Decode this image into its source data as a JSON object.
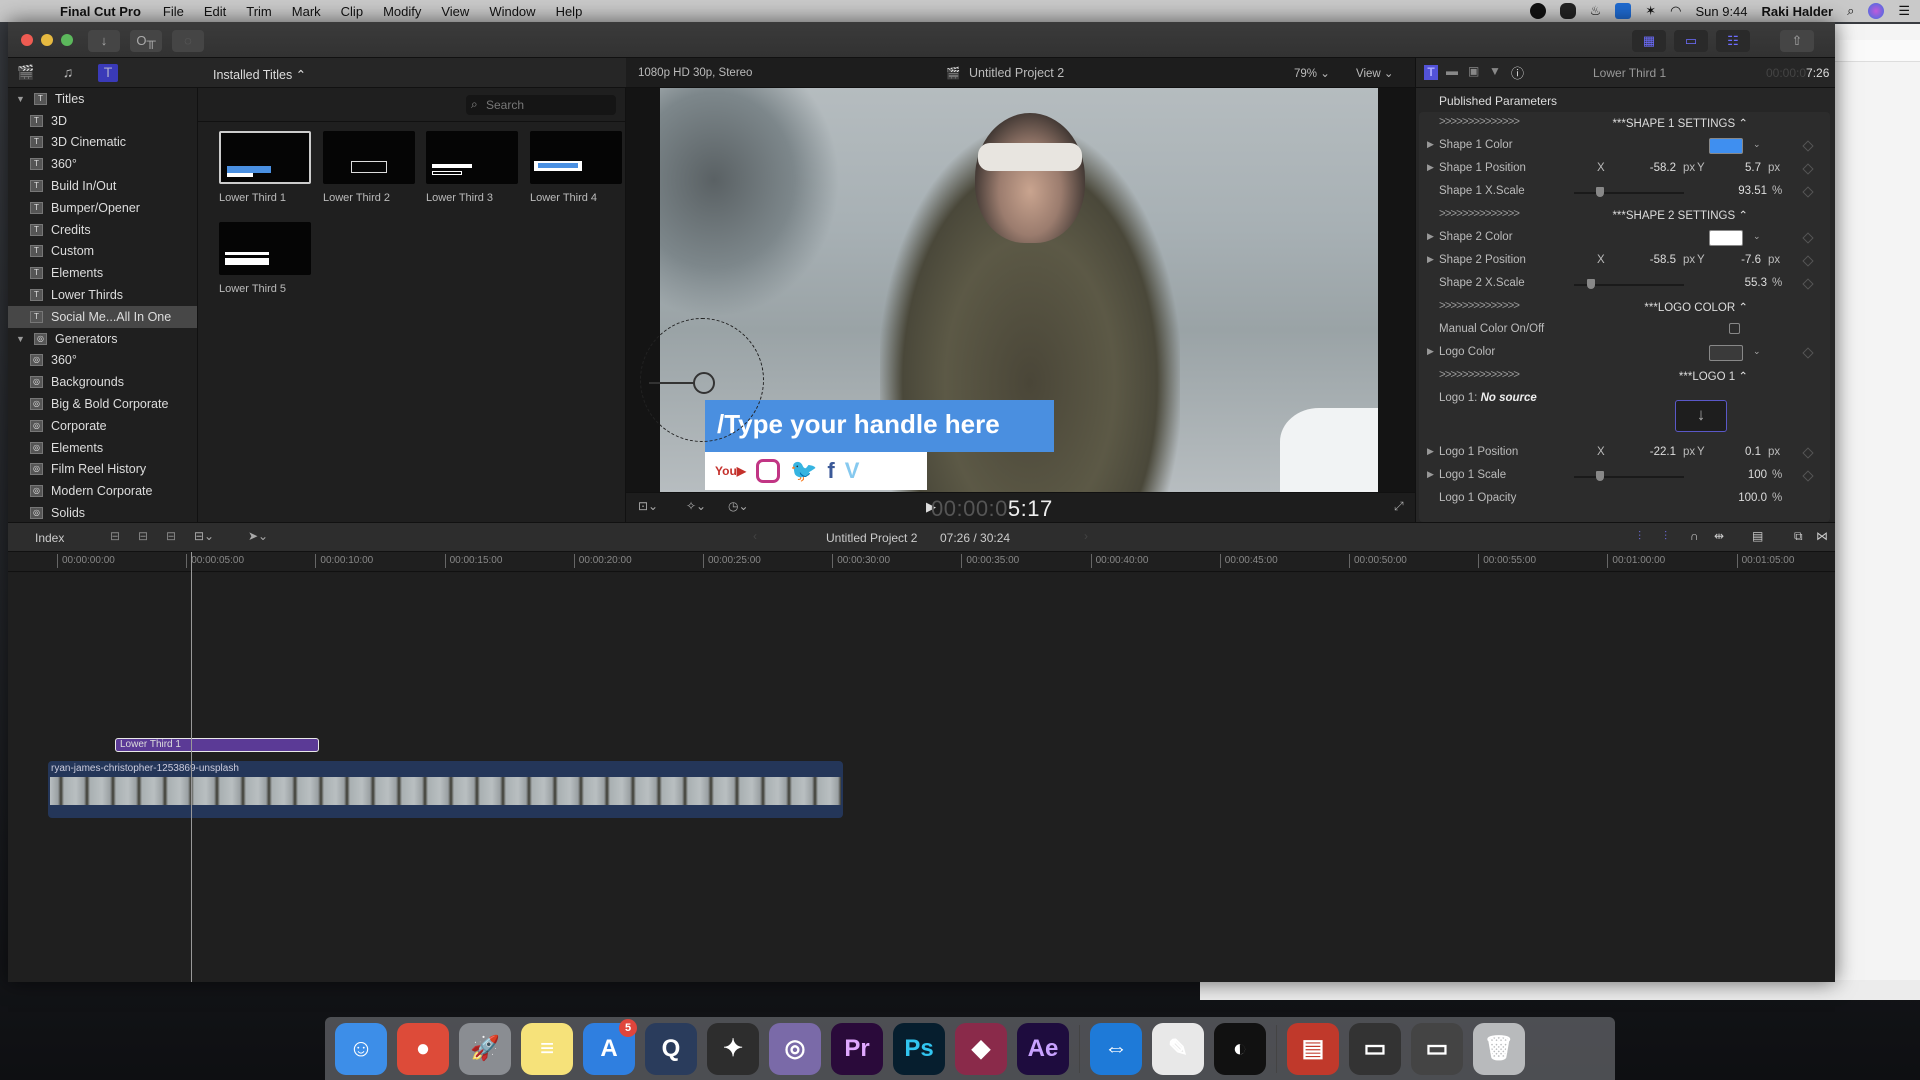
{
  "menubar": {
    "app_name": "Final Cut Pro",
    "menus": [
      "File",
      "Edit",
      "Trim",
      "Mark",
      "Clip",
      "Modify",
      "View",
      "Window",
      "Help"
    ],
    "clock": "Sun 9:44",
    "user": "Raki Halder",
    "status_icons": [
      "obs-icon",
      "creative-cloud-icon",
      "fan-icon",
      "teamviewer-icon",
      "avast-icon",
      "wifi-icon"
    ]
  },
  "toolbar": {
    "import_icon": "↓",
    "keywords_icon": "O╥",
    "bg_tasks_icon": "◌",
    "share_icon": "⇧"
  },
  "sidebar": {
    "groups": [
      {
        "label": "Titles",
        "items": [
          "3D",
          "3D Cinematic",
          "360°",
          "Build In/Out",
          "Bumper/Opener",
          "Credits",
          "Custom",
          "Elements",
          "Lower Thirds",
          "Social Me...All In One"
        ]
      },
      {
        "label": "Generators",
        "items": [
          "360°",
          "Backgrounds",
          "Big & Bold Corporate",
          "Corporate",
          "Elements",
          "Film Reel History",
          "Modern Corporate",
          "Solids"
        ]
      }
    ],
    "selected": "Social Me...All In One"
  },
  "browser": {
    "header": "Installed Titles ⌃",
    "search_placeholder": "Search",
    "thumbs": [
      "Lower Third 1",
      "Lower Third 2",
      "Lower Third 3",
      "Lower Third 4",
      "Lower Third 5"
    ],
    "selected": "Lower Third 1"
  },
  "viewer": {
    "format": "1080p HD 30p, Stereo",
    "project": "Untitled Project 2",
    "zoom": "79%",
    "view_label": "View",
    "overlay_title": "/Type your handle here",
    "social_icons": [
      "youtube-icon",
      "instagram-icon",
      "twitter-icon",
      "facebook-icon",
      "vimeo-icon"
    ],
    "timecode_dim": "00:00:0",
    "timecode_bright": "5:17"
  },
  "inspector": {
    "title": "Lower Third 1",
    "duration_dim": "00:00:0",
    "duration_bright": "7:26",
    "published_params": "Published Parameters",
    "chevrons": ">>>>>>>>>>>>>>",
    "rows": {
      "shape1_section": "***SHAPE 1 SETTINGS ⌃",
      "shape1_color": {
        "label": "Shape 1 Color",
        "color": "#3f8ff0"
      },
      "shape1_pos": {
        "label": "Shape 1 Position",
        "x": "-58.2",
        "y": "5.7",
        "unit": "px"
      },
      "shape1_scale": {
        "label": "Shape 1 X.Scale",
        "value": "93.51",
        "unit": "%",
        "fraction": 0.2
      },
      "shape2_section": "***SHAPE 2 SETTINGS ⌃",
      "shape2_color": {
        "label": "Shape 2 Color",
        "color": "#ffffff"
      },
      "shape2_pos": {
        "label": "Shape 2 Position",
        "x": "-58.5",
        "y": "-7.6",
        "unit": "px"
      },
      "shape2_scale": {
        "label": "Shape 2 X.Scale",
        "value": "55.3",
        "unit": "%",
        "fraction": 0.12
      },
      "logo_color_section": "***LOGO COLOR ⌃",
      "manual_color": {
        "label": "Manual Color On/Off",
        "checked": false
      },
      "logo_color": {
        "label": "Logo Color",
        "color": "#3a3a3a"
      },
      "logo1_section": "***LOGO 1 ⌃",
      "logo1_source": {
        "label": "Logo 1:",
        "value": "No source"
      },
      "logo1_pos": {
        "label": "Logo 1 Position",
        "x": "-22.1",
        "y": "0.1",
        "unit": "px"
      },
      "logo1_scale": {
        "label": "Logo 1 Scale",
        "value": "100",
        "unit": "%",
        "fraction": 0.2
      },
      "logo1_opacity": {
        "label": "Logo 1 Opacity",
        "value": "100.0",
        "unit": "%"
      }
    },
    "x_label": "X",
    "y_label": "Y"
  },
  "timeline": {
    "index_label": "Index",
    "project": "Untitled Project 2",
    "position": "07:26 / 30:24",
    "ruler": [
      "00:00:00:00",
      "00:00:05:00",
      "00:00:10:00",
      "00:00:15:00",
      "00:00:20:00",
      "00:00:25:00",
      "00:00:30:00",
      "00:00:35:00",
      "00:00:40:00",
      "00:00:45:00",
      "00:00:50:00",
      "00:00:55:00",
      "00:01:00:00",
      "00:01:05:00"
    ],
    "title_clip": "Lower Third 1",
    "video_clip": "ryan-james-christopher-1253869-unsplash"
  },
  "dock": {
    "apps": [
      {
        "name": "finder",
        "glyph": "☺",
        "bg": "#3d8ee8"
      },
      {
        "name": "chrome",
        "glyph": "●",
        "bg": "#dd4b39"
      },
      {
        "name": "launchpad",
        "glyph": "🚀",
        "bg": "#8a8d92"
      },
      {
        "name": "notes",
        "glyph": "≡",
        "bg": "#f6e27a"
      },
      {
        "name": "app-store",
        "glyph": "A",
        "bg": "#2f7fe0",
        "badge": "5"
      },
      {
        "name": "quicktime",
        "glyph": "Q",
        "bg": "#2a3c5c"
      },
      {
        "name": "final-cut-pro",
        "glyph": "✦",
        "bg": "#2d2d2d"
      },
      {
        "name": "motion",
        "glyph": "◎",
        "bg": "#7a6aa8"
      },
      {
        "name": "premiere-pro",
        "glyph": "Pr",
        "bg": "#2a0a3a"
      },
      {
        "name": "photoshop",
        "glyph": "Ps",
        "bg": "#061e2e"
      },
      {
        "name": "media-encoder",
        "glyph": "◆",
        "bg": "#8a2a4a"
      },
      {
        "name": "after-effects",
        "glyph": "Ae",
        "bg": "#1e0c3e"
      },
      {
        "name": "teamviewer",
        "glyph": "⇔",
        "bg": "#1e7ad8"
      },
      {
        "name": "textedit",
        "glyph": "✎",
        "bg": "#e8e8e8"
      },
      {
        "name": "obs",
        "glyph": "◐",
        "bg": "#111111"
      },
      {
        "name": "archive",
        "glyph": "▤",
        "bg": "#c0392b"
      },
      {
        "name": "window-preview-1",
        "glyph": "▭",
        "bg": "#333333"
      },
      {
        "name": "window-preview-2",
        "glyph": "▭",
        "bg": "#444444"
      },
      {
        "name": "trash",
        "glyph": "🗑",
        "bg": "#b8babc"
      }
    ]
  }
}
